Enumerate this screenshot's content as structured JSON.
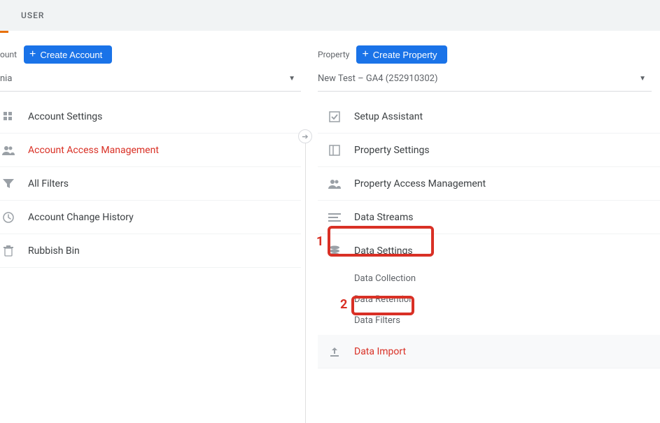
{
  "top": {
    "tab_user": "USER"
  },
  "account": {
    "label": "ount",
    "create_btn": "Create Account",
    "selector_value": "nia",
    "items": [
      {
        "label": "Account Settings"
      },
      {
        "label": "Account Access Management"
      },
      {
        "label": "All Filters"
      },
      {
        "label": "Account Change History"
      },
      {
        "label": "Rubbish Bin"
      }
    ]
  },
  "property": {
    "label": "Property",
    "create_btn": "Create Property",
    "selector_value": "New Test  – GA4 (252910302)",
    "items": [
      {
        "label": "Setup Assistant"
      },
      {
        "label": "Property Settings"
      },
      {
        "label": "Property Access Management"
      },
      {
        "label": "Data Streams"
      },
      {
        "label": "Data Settings"
      },
      {
        "label": "Data Import"
      }
    ],
    "data_settings_sub": [
      "Data Collection",
      "Data Retention",
      "Data Filters"
    ]
  },
  "annotations": {
    "n1": "1",
    "n2": "2"
  }
}
